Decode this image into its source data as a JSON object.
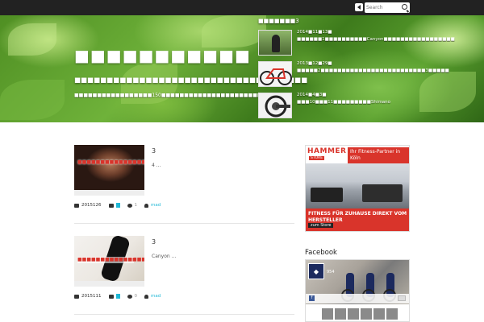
{
  "topbar": {
    "search_placeholder": "Search"
  },
  "header": {
    "site_title": "■■■■■■■■■■■",
    "subtitle": "■■■■■■■■■■■■■■■■■■■■■■■■■■■■■■■■■■■■",
    "description": "■■■■■■■■■■■■■■■■■150■■■■■■■■■■■■■■■■■■■■■■■■■■■■■■■■■■■■■",
    "popular_heading": "■■■■■■■3",
    "popular": [
      {
        "date": "2014■11■13■",
        "title": "■■■■■■1■■■■■■■■■■Canyon■■■■■■■■■■■■■■■■■"
      },
      {
        "date": "2013■12■29■",
        "title": "■■■■■2■■■■■■■■■■■■■■■■■■■■■■■■■3■■■■■"
      },
      {
        "date": "2014■4■3■",
        "title": "■■■10■■■11■■■■■■■■■Shimano"
      }
    ]
  },
  "posts": [
    {
      "title": "3",
      "excerpt": "4 ...",
      "thumb_text": "■■■■■■■■■■■■■■■■■■■■■■",
      "date": "2015126",
      "comments": "1",
      "author": "mad"
    },
    {
      "title": "3",
      "excerpt": "Canyon ...",
      "thumb_text": "■■■■■■■■■■■■■■■■■■",
      "date": "2015111",
      "comments": "0",
      "author": "mad"
    }
  ],
  "ad": {
    "brand": "HAMMER",
    "brand_sub": "STORE",
    "headline": "Ihr Fitness-Partner in Köln",
    "footer": "FITNESS FÜR ZUHAUSE DIREKT VOM HERSTELLER",
    "button": "zum Store"
  },
  "facebook": {
    "title": "Facebook",
    "page_name": "954"
  }
}
